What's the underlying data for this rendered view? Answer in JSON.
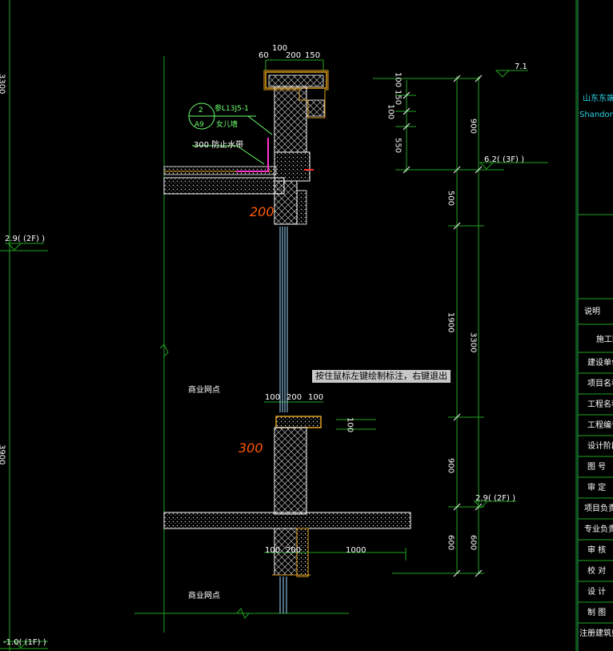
{
  "prompt": {
    "tooltip": "按住鼠标左键绘制标注，右键退出"
  },
  "labels": {
    "commercial_upper": "商业网点",
    "commercial_lower": "商业网点",
    "callout_top": "2",
    "callout_bottom": "A9",
    "ref_code": "参L13J5-1",
    "ref_note": "女儿墙",
    "waterproof": "300 防止水带"
  },
  "handwritten": {
    "note_200": "200",
    "note_300": "300"
  },
  "levels": {
    "level_71": "7.1",
    "level_62": "6.2( (3F) )",
    "level_29_right": "2.9( (2F) )",
    "level_29_left": "2.9( (2F) )",
    "level_m10": "-1.0( (1F) )"
  },
  "dims": {
    "top": [
      "100",
      "60",
      "200",
      "150"
    ],
    "mid": [
      "100",
      "200",
      "100"
    ],
    "bottom": [
      "100",
      "200",
      "1000"
    ],
    "vertical_inner": [
      "100",
      "150",
      "100",
      "550",
      "500",
      "1900",
      "900",
      "600"
    ],
    "vertical_outer": [
      "900",
      "3300",
      "600"
    ],
    "canopy": "100",
    "left_edge": [
      "3300",
      "3900"
    ]
  },
  "title_block": {
    "company": "山东东端",
    "company_en": "Shandong Dong",
    "rows": [
      "说明",
      "施工图",
      "建设单位",
      "项目名称",
      "工程名称",
      "工程编号",
      "设计阶段",
      "图 号",
      "审 定",
      "项目负责人",
      "专业负责人",
      "审 核",
      "校 对",
      "设 计",
      "制 图",
      "注册建筑师专用"
    ]
  }
}
